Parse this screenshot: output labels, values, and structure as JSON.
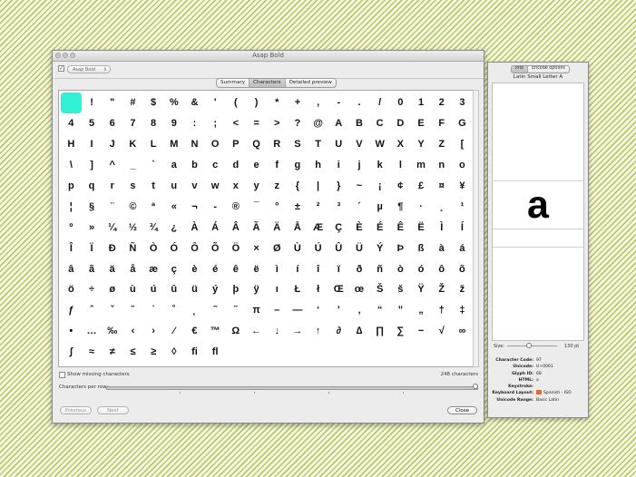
{
  "window": {
    "title": "Asap Bold"
  },
  "toolbar": {
    "font_popup": "Asap Bold",
    "checkbox": "✓"
  },
  "tabs": [
    {
      "label": "Summary",
      "selected": false
    },
    {
      "label": "Characters",
      "selected": true
    },
    {
      "label": "Detailed preview",
      "selected": false
    }
  ],
  "characters": [
    "",
    "!",
    "\"",
    "#",
    "$",
    "%",
    "&",
    "'",
    "(",
    ")",
    "*",
    "+",
    ",",
    "-",
    ".",
    "/",
    "0",
    "1",
    "2",
    "3",
    "4",
    "5",
    "6",
    "7",
    "8",
    "9",
    ":",
    ";",
    "<",
    "=",
    ">",
    "?",
    "@",
    "A",
    "B",
    "C",
    "D",
    "E",
    "F",
    "G",
    "H",
    "I",
    "J",
    "K",
    "L",
    "M",
    "N",
    "O",
    "P",
    "Q",
    "R",
    "S",
    "T",
    "U",
    "V",
    "W",
    "X",
    "Y",
    "Z",
    "[",
    "\\",
    "]",
    "^",
    "_",
    "`",
    "a",
    "b",
    "c",
    "d",
    "e",
    "f",
    "g",
    "h",
    "i",
    "j",
    "k",
    "l",
    "m",
    "n",
    "o",
    "p",
    "q",
    "r",
    "s",
    "t",
    "u",
    "v",
    "w",
    "x",
    "y",
    "z",
    "{",
    "|",
    "}",
    "~",
    "¡",
    "¢",
    "£",
    "¤",
    "¥",
    "¦",
    "§",
    "¨",
    "©",
    "ª",
    "«",
    "¬",
    "-",
    "®",
    "¯",
    "°",
    "±",
    "²",
    "³",
    "´",
    "µ",
    "¶",
    "·",
    "¸",
    "¹",
    "º",
    "»",
    "¼",
    "½",
    "¾",
    "¿",
    "À",
    "Á",
    "Â",
    "Ã",
    "Ä",
    "Å",
    "Æ",
    "Ç",
    "È",
    "É",
    "Ê",
    "Ë",
    "Ì",
    "Í",
    "Î",
    "Ï",
    "Ð",
    "Ñ",
    "Ò",
    "Ó",
    "Ô",
    "Õ",
    "Ö",
    "×",
    "Ø",
    "Ù",
    "Ú",
    "Û",
    "Ü",
    "Ý",
    "Þ",
    "ß",
    "à",
    "á",
    "â",
    "ã",
    "ä",
    "å",
    "æ",
    "ç",
    "è",
    "é",
    "ê",
    "ë",
    "ì",
    "í",
    "î",
    "ï",
    "ð",
    "ñ",
    "ò",
    "ó",
    "ô",
    "õ",
    "ö",
    "÷",
    "ø",
    "ù",
    "ú",
    "û",
    "ü",
    "ý",
    "þ",
    "ÿ",
    "ı",
    "Ł",
    "ł",
    "Œ",
    "œ",
    "Š",
    "š",
    "Ÿ",
    "Ž",
    "ž",
    "ƒ",
    "ˆ",
    "ˇ",
    "˘",
    "˙",
    "˚",
    "˛",
    "˜",
    "˝",
    "π",
    "–",
    "—",
    "‘",
    "’",
    "‚",
    "“",
    "”",
    "„",
    "†",
    "‡",
    "•",
    "…",
    "‰",
    "‹",
    "›",
    "⁄",
    "€",
    "™",
    "Ω",
    "←",
    "↓",
    "→",
    "↑",
    "∂",
    "∆",
    "∏",
    "∑",
    "−",
    "√",
    "∞",
    "∫",
    "≈",
    "≠",
    "≤",
    "≥",
    "◊",
    "ﬁ",
    "ﬂ"
  ],
  "selected_index": 0,
  "footer": {
    "show_missing": "Show missing characters",
    "count": "248 characters",
    "per_row": "Characters per row:",
    "previous": "Previous",
    "next": "Next",
    "close": "Close"
  },
  "panel": {
    "tabs": [
      {
        "label": "Info",
        "selected": true
      },
      {
        "label": "Encode options",
        "selected": false
      }
    ],
    "glyph_name": "Latin Small Letter A",
    "glyph": "a",
    "size_label": "Size:",
    "size_value": "130 pt",
    "info": [
      {
        "k": "Character Code:",
        "v": "97"
      },
      {
        "k": "Unicode:",
        "v": "U+0061"
      },
      {
        "k": "Glyph ID:",
        "v": "68"
      },
      {
        "k": "HTML:",
        "v": "a"
      },
      {
        "k": "Keystroke:",
        "v": ""
      },
      {
        "k": "Keyboard Layout:",
        "v": "Spanish - ISO"
      },
      {
        "k": "Unicode Range:",
        "v": "Basic Latin"
      }
    ]
  }
}
